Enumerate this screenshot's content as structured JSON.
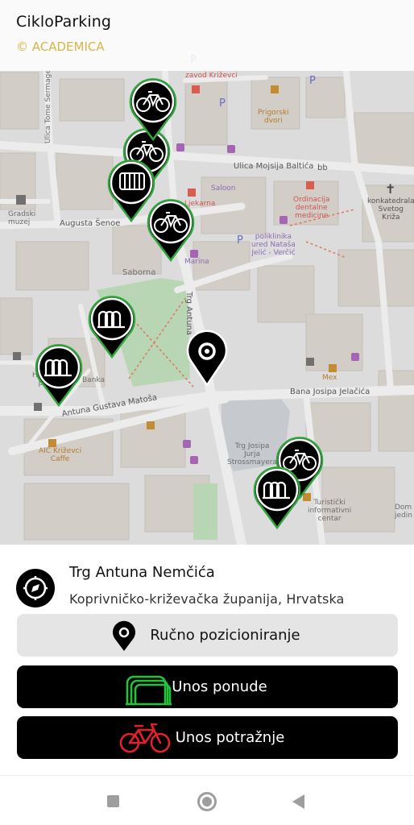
{
  "app": {
    "title": "CikloParking",
    "subtitle": "© ACADEMICA"
  },
  "map": {
    "labels": {
      "ulica_tome_sermage": "Ulica Tome Sermage",
      "zavod": "zavod\nKriževci",
      "p1": "P",
      "p2": "P",
      "p3": "P",
      "p4": "P",
      "prigorski_dvori": "Prigorski\ndvori",
      "ulica_mojsija_baltica": "Ulica Mojsija Baltića",
      "bb": "bb",
      "saloon": "Saloon",
      "ordinacija": "Ordinacija\ndentalne\nmedicine",
      "konkatedrala": "konkatedrala\nSvetog\nKriža",
      "augusta_senoe": "Augusta Šenoe",
      "gradski_muzej": "Gradski\nmuzej",
      "ljekarna": "Ljekarna",
      "polikl": "poliklinika\nured Nataša\nJelić - Verčić",
      "marina": "Marina",
      "saborna": "Saborna",
      "trg_antuna": "Trg Antuna",
      "bana_josipa_jelacica": "Bana Josipa Jelačića",
      "antuna_gustava_matosa": "Antuna Gustava Matoša",
      "hrvatska_posta": "Hrvatska\npošta",
      "banka": "Banka",
      "trg_josipa": "Trg Josipa\nJurja\nStrossmayera",
      "turisticki": "Turistički\ninformativni\ncentar",
      "caffe": "AIC Križevci\nCaffe",
      "mex": "Mex",
      "dom": "Dom\njedin"
    }
  },
  "location": {
    "title": "Trg Antuna Nemčića",
    "subtitle": "Koprivničko-križevačka županija, Hrvatska"
  },
  "buttons": {
    "manual": "Ručno pozicioniranje",
    "offer": "Unos ponude",
    "demand": "Unos potražnje"
  },
  "colors": {
    "accent_gold": "#d6b64a",
    "marker_green": "#2fa43b",
    "offer_icon_green": "#22c33a",
    "demand_icon_red": "#e4202a"
  },
  "icons": {
    "location": "crosshair-compass-icon",
    "pin": "map-pin-icon",
    "offer": "bike-rack-icon",
    "demand": "bicycle-icon"
  }
}
